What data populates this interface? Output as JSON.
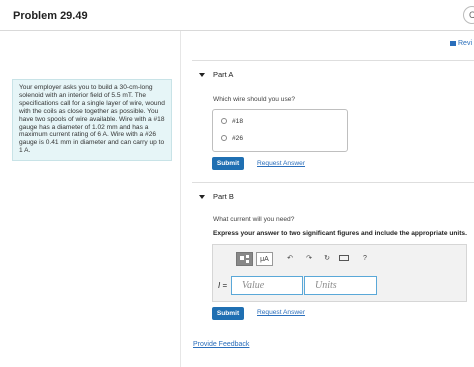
{
  "header": {
    "title": "Problem 29.49",
    "corner_button_glyph": "C"
  },
  "intro": {
    "text": "Your employer asks you to build a 30-cm-long solenoid with an interior field of 5.5 mT. The specifications call for a single layer of wire, wound with the coils as close together as possible. You have two spools of wire available. Wire with a #18 gauge has a diameter of 1.02 mm and has a maximum current rating of 6 A. Wire with a #26 gauge is 0.41 mm in diameter and can carry up to 1 A."
  },
  "review_link": {
    "label": "Revi",
    "icon": "review-icon"
  },
  "part_a": {
    "label": "Part A",
    "question": "Which wire should you use?",
    "options": [
      "#18",
      "#26"
    ],
    "submit_label": "Submit",
    "request_label": "Request Answer"
  },
  "part_b": {
    "label": "Part B",
    "question": "What current will you need?",
    "instruction": "Express your answer to two significant figures and include the appropriate units.",
    "toolbar": {
      "units_button": "μA",
      "icons": [
        "templates-icon",
        "undo-icon",
        "redo-icon",
        "reset-icon",
        "keyboard-icon",
        "help-icon"
      ],
      "help_glyph": "?"
    },
    "variable": "I",
    "equals": "=",
    "value_placeholder": "Value",
    "units_placeholder": "Units",
    "submit_label": "Submit",
    "request_label": "Request Answer"
  },
  "feedback_link": "Provide Feedback",
  "colors": {
    "accent": "#1f6fb2",
    "link": "#2a6ebb",
    "intro_bg": "#e6f5f7",
    "field_border": "#5aa8d8"
  }
}
